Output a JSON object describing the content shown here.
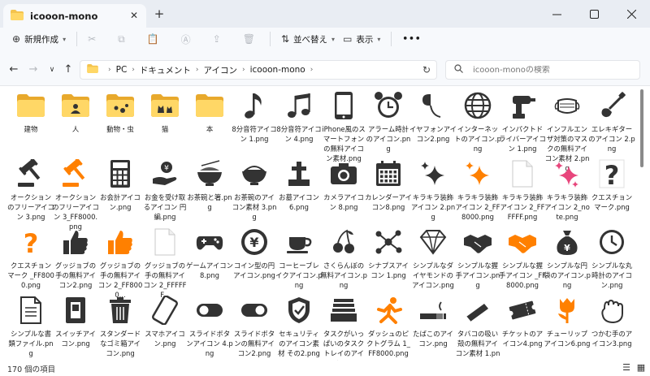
{
  "tab": {
    "title": "icooon-mono"
  },
  "window_controls": [
    "minimize",
    "maximize",
    "close"
  ],
  "toolbar": {
    "new_label": "新規作成",
    "sort_label": "並べ替え",
    "view_label": "表示",
    "more_label": "•••"
  },
  "address": {
    "crumbs": [
      "PC",
      "ドキュメント",
      "アイコン",
      "icooon-mono"
    ]
  },
  "search": {
    "placeholder": "icooon-monoの検索"
  },
  "items": [
    {
      "label": "建物",
      "icon": "folder-icon"
    },
    {
      "label": "人",
      "icon": "folder-person-icon"
    },
    {
      "label": "動物・虫",
      "icon": "folder-animals-icon"
    },
    {
      "label": "猫",
      "icon": "folder-cats-icon"
    },
    {
      "label": "本",
      "icon": "folder-icon"
    },
    {
      "label": "8分音符アイコン 1.png",
      "icon": "eighth-note-icon"
    },
    {
      "label": "8分音符アイコン 4.png",
      "icon": "beamed-notes-icon"
    },
    {
      "label": "iPhone風のスマートフォンの無料アイコン素材.png",
      "icon": "smartphone-icon"
    },
    {
      "label": "アラーム時計のアイコン.png",
      "icon": "alarm-clock-icon"
    },
    {
      "label": "イヤフォンアイコン2.png",
      "icon": "earphone-icon"
    },
    {
      "label": "インターネットのアイコン.png",
      "icon": "globe-icon"
    },
    {
      "label": "インパクトドライバーアイコン 1.png",
      "icon": "impact-driver-icon"
    },
    {
      "label": "インフルエンザ対策のマスクの無料アイコン素材 2.png",
      "icon": "mask-icon"
    },
    {
      "label": "エレキギターのアイコン 2.png",
      "icon": "electric-guitar-icon"
    },
    {
      "label": "オークションのフリーアイコン 3.png",
      "icon": "gavel-icon"
    },
    {
      "label": "オークションのフリーアイコン 3_FF8000.png",
      "icon": "gavel-orange-icon"
    },
    {
      "label": "お会計アイコン.png",
      "icon": "calculator-icon"
    },
    {
      "label": "お金を受け取るアイコン 円編.png",
      "icon": "receive-money-icon"
    },
    {
      "label": "お茶碗と箸.png",
      "icon": "rice-bowl-chopsticks-icon"
    },
    {
      "label": "お茶碗のアイコン素材 3.png",
      "icon": "rice-bowl-icon"
    },
    {
      "label": "お墓アイコン 6.png",
      "icon": "grave-icon"
    },
    {
      "label": "カメラアイコン 8.png",
      "icon": "camera-icon"
    },
    {
      "label": "カレンダーアイコン8.png",
      "icon": "calendar-icon"
    },
    {
      "label": "キラキラ装飾アイコン 2.png",
      "icon": "sparkle-icon"
    },
    {
      "label": "キラキラ装飾アイコン 2_FF8000.png",
      "icon": "sparkle-orange-icon"
    },
    {
      "label": "キラキラ装飾アイコン 2_FFFFFF.png",
      "icon": "blank-page-icon"
    },
    {
      "label": "キラキラ装飾アイコン 2_note.png",
      "icon": "sparkle-pink-icon"
    },
    {
      "label": "クエスチョンマーク.png",
      "icon": "question-mark-icon"
    },
    {
      "label": "クエスチョンマーク _FF8000.png",
      "icon": "question-mark-orange-icon"
    },
    {
      "label": "グッジョブの手の無料アイコン2.png",
      "icon": "thumbs-up-icon"
    },
    {
      "label": "グッジョブの手の無料アイコン 2_FF8000...",
      "icon": "thumbs-up-orange-icon"
    },
    {
      "label": "グッジョブの手の無料アイコン 2_FFFFFF...",
      "icon": "blank-page-icon"
    },
    {
      "label": "ゲームアイコン 8.png",
      "icon": "game-controller-icon"
    },
    {
      "label": "コイン型の円アイコン.png",
      "icon": "yen-coin-icon"
    },
    {
      "label": "コーヒーブレイクアイコン.png",
      "icon": "coffee-cup-icon"
    },
    {
      "label": "さくらんぼの無料アイコン.png",
      "icon": "cherry-icon"
    },
    {
      "label": "シナプスアイコン 1.png",
      "icon": "synapse-icon"
    },
    {
      "label": "シンプルなダイヤモンドのアイコン.png",
      "icon": "diamond-icon"
    },
    {
      "label": "シンプルな握手アイコン.png",
      "icon": "handshake-icon"
    },
    {
      "label": "シンプルな握手アイコン _FF8000.png",
      "icon": "handshake-orange-icon"
    },
    {
      "label": "シンプルな円袋のアイコン.png",
      "icon": "money-bag-icon"
    },
    {
      "label": "シンプルな丸時計のアイコン.png",
      "icon": "round-clock-icon"
    },
    {
      "label": "シンプルな書類ファイル.png",
      "icon": "document-icon"
    },
    {
      "label": "スイッチアイコン.png",
      "icon": "switch-icon"
    },
    {
      "label": "スタンダードなゴミ箱アイコン.png",
      "icon": "trash-can-icon"
    },
    {
      "label": "スマホアイコン.png",
      "icon": "tilted-phone-icon"
    },
    {
      "label": "スライドボタンアイコン 4.png",
      "icon": "toggle-off-icon"
    },
    {
      "label": "スライドボタンの無料アイコン2.png",
      "icon": "toggle-on-icon"
    },
    {
      "label": "セキュリティのアイコン素材 その2.png",
      "icon": "security-shield-icon"
    },
    {
      "label": "タスクがいっぱいのタスクトレイのアイコン.png",
      "icon": "task-tray-icon"
    },
    {
      "label": "ダッシュのピクトグラム 1_FF8000.png",
      "icon": "dash-pictogram-orange-icon"
    },
    {
      "label": "たばこのアイコン.png",
      "icon": "cigarette-icon"
    },
    {
      "label": "タバコの吸い殻の無料アイコン素材 1.png",
      "icon": "cigarette-butt-icon"
    },
    {
      "label": "チケットのアイコン4.png",
      "icon": "ticket-icon"
    },
    {
      "label": "チューリップアイコン6.png",
      "icon": "tulip-orange-icon"
    },
    {
      "label": "つかむ手のアイコン3.png",
      "icon": "grab-hand-icon"
    }
  ],
  "status": {
    "count_text": "170 個の項目"
  },
  "colors": {
    "folder": "#f4c34d",
    "orange": "#ff8000",
    "pink": "#e8467c",
    "icon_dark": "#333333"
  }
}
